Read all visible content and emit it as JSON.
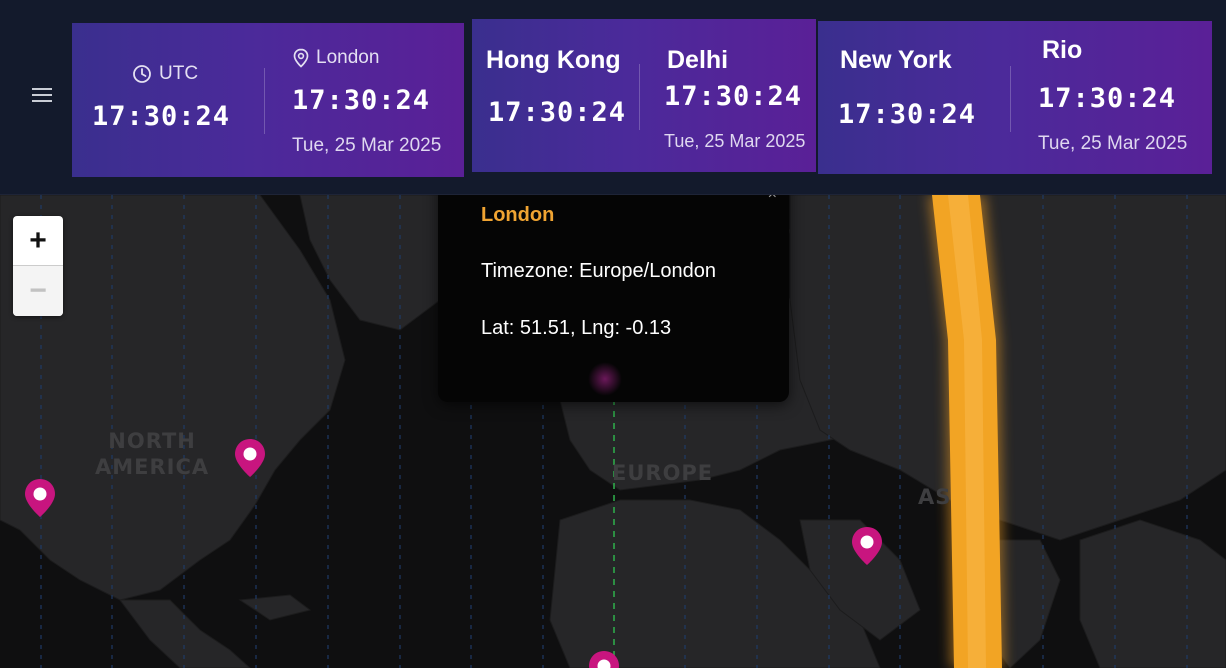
{
  "menu": {
    "icon": "hamburger-menu-icon"
  },
  "cards": [
    {
      "left": {
        "label": "UTC",
        "icon": "clock-icon",
        "time": "17:30:24"
      },
      "right": {
        "label": "London",
        "icon": "location-pin-icon",
        "time": "17:30:24",
        "date": "Tue, 25 Mar 2025"
      }
    },
    {
      "left": {
        "city": "Hong Kong",
        "time": "17:30:24"
      },
      "right": {
        "city": "Delhi",
        "time": "17:30:24",
        "date": "Tue, 25 Mar 2025"
      }
    },
    {
      "left": {
        "city": "New York",
        "time": "17:30:24"
      },
      "right": {
        "city": "Rio",
        "time": "17:30:24",
        "date": "Tue, 25 Mar 2025"
      }
    }
  ],
  "zoom": {
    "in_label": "+",
    "out_label": "−"
  },
  "popup": {
    "title": "London",
    "timezone": "Timezone: Europe/London",
    "coords": "Lat: 51.51, Lng: -0.13",
    "close_label": "×"
  },
  "map": {
    "labels": {
      "north_america": "NORTH\nAMERICA",
      "europe": "EUROPE",
      "asia_partial": "AS"
    },
    "colors": {
      "pin": "#c8157f",
      "terminator": "#f5a020",
      "meridian": "#2ea84a",
      "timezone_lines": "#1e3a66"
    }
  }
}
